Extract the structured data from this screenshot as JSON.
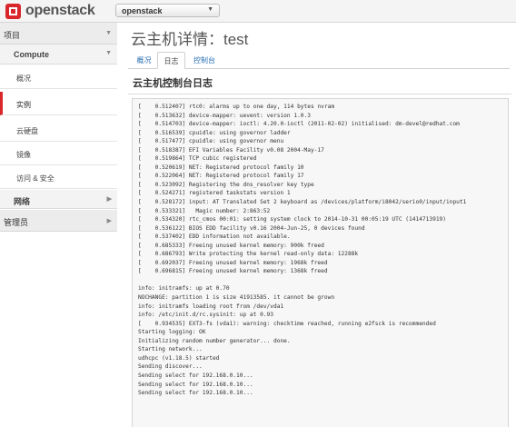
{
  "header": {
    "brand": "openstack",
    "project_selector": "openstack"
  },
  "sidebar": {
    "project_label": "项目",
    "compute_label": "Compute",
    "items": [
      {
        "label": "概况",
        "active": false
      },
      {
        "label": "实例",
        "active": true
      },
      {
        "label": "云硬盘",
        "active": false
      },
      {
        "label": "镜像",
        "active": false
      },
      {
        "label": "访问 & 安全",
        "active": false
      }
    ],
    "network_label": "网络",
    "admin_label": "管理员"
  },
  "main": {
    "title": "云主机详情：test",
    "tabs": [
      {
        "label": "概况",
        "active": false
      },
      {
        "label": "日志",
        "active": true
      },
      {
        "label": "控制台",
        "active": false
      }
    ],
    "section_title": "云主机控制台日志",
    "console_lines": [
      "[    0.512407] rtc0: alarms up to one day, 114 bytes nvram",
      "[    0.513632] device-mapper: uevent: version 1.0.3",
      "[    0.514703] device-mapper: ioctl: 4.20.0-ioctl (2011-02-02) initialised: dm-devel@redhat.com",
      "[    0.516539] cpuidle: using governor ladder",
      "[    0.517477] cpuidle: using governor menu",
      "[    0.518387] EFI Variables Facility v0.08 2004-May-17",
      "[    0.519864] TCP cubic registered",
      "[    0.520619] NET: Registered protocol family 10",
      "[    0.522064] NET: Registered protocol family 17",
      "[    0.523092] Registering the dns_resolver key type",
      "[    0.524271] registered taskstats version 1",
      "[    0.528172] input: AT Translated Set 2 keyboard as /devices/platform/i8042/serio0/input/input1",
      "[    0.533321]   Magic number: 2:863:52",
      "[    0.534320] rtc_cmos 00:01: setting system clock to 2014-10-31 00:05:19 UTC (1414713919)",
      "[    0.536122] BIOS EDD facility v0.16 2004-Jun-25, 0 devices found",
      "[    0.537402] EDD information not available.",
      "[    0.685333] Freeing unused kernel memory: 900k freed",
      "[    0.686793] Write protecting the kernel read-only data: 12288k",
      "[    0.692037] Freeing unused kernel memory: 1968k freed",
      "[    0.696815] Freeing unused kernel memory: 1368k freed",
      "",
      "info: initramfs: up at 0.70",
      "NOCHANGE: partition 1 is size 41913585. it cannot be grown",
      "info: initramfs loading root from /dev/vda1",
      "info: /etc/init.d/rc.sysinit: up at 0.93",
      "[    0.934535] EXT3-fs (vda1): warning: checktime reached, running e2fsck is recommended",
      "Starting logging: OK",
      "Initializing random number generator... done.",
      "Starting network...",
      "udhcpc (v1.18.5) started",
      "Sending discover...",
      "Sending select for 192.168.0.10...",
      "Sending select for 192.168.0.10...",
      "Sending select for 192.168.0.10..."
    ]
  }
}
